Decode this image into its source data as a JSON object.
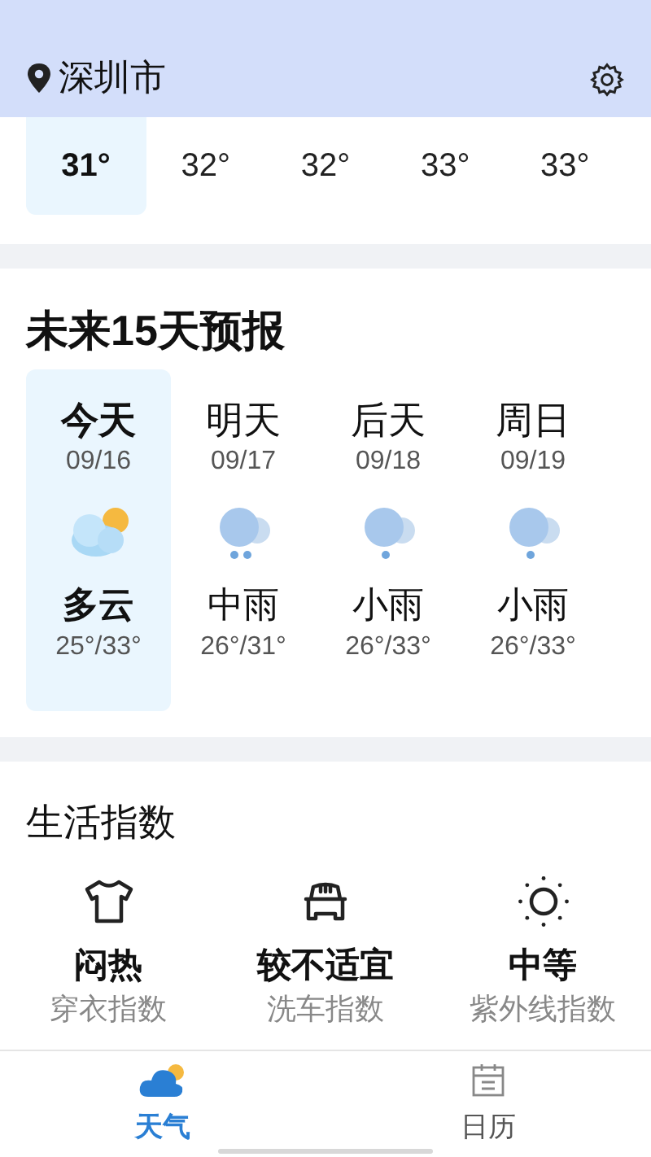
{
  "header": {
    "city": "深圳市"
  },
  "hourly": [
    {
      "temp": "31°",
      "selected": true
    },
    {
      "temp": "32°",
      "selected": false
    },
    {
      "temp": "32°",
      "selected": false
    },
    {
      "temp": "33°",
      "selected": false
    },
    {
      "temp": "33°",
      "selected": false
    }
  ],
  "forecast": {
    "title": "未来15天预报",
    "days": [
      {
        "day": "今天",
        "date": "09/16",
        "kind": "partly_cloudy",
        "condition": "多云",
        "range": "25°/33°",
        "selected": true
      },
      {
        "day": "明天",
        "date": "09/17",
        "kind": "rain_medium",
        "condition": "中雨",
        "range": "26°/31°",
        "selected": false
      },
      {
        "day": "后天",
        "date": "09/18",
        "kind": "rain_light",
        "condition": "小雨",
        "range": "26°/33°",
        "selected": false
      },
      {
        "day": "周日",
        "date": "09/19",
        "kind": "rain_light",
        "condition": "小雨",
        "range": "26°/33°",
        "selected": false
      }
    ]
  },
  "life_index": {
    "title": "生活指数",
    "items": [
      {
        "kind": "shirt",
        "value": "闷热",
        "label": "穿衣指数"
      },
      {
        "kind": "car",
        "value": "较不适宜",
        "label": "洗车指数"
      },
      {
        "kind": "sun",
        "value": "中等",
        "label": "紫外线指数"
      }
    ]
  },
  "tabs": [
    {
      "kind": "weather",
      "label": "天气",
      "selected": true
    },
    {
      "kind": "calendar",
      "label": "日历",
      "selected": false
    }
  ]
}
